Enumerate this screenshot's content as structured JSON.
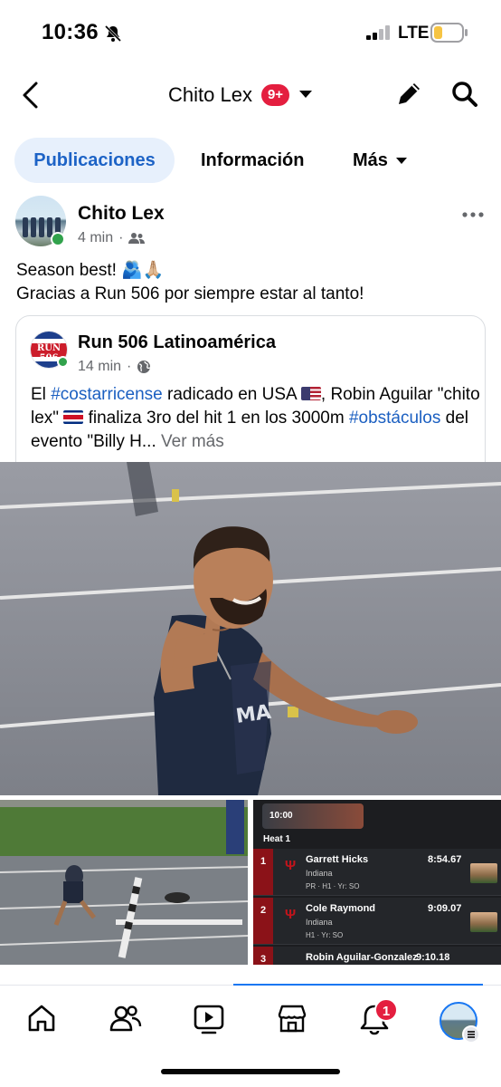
{
  "status_bar": {
    "time": "10:36",
    "network": "LTE",
    "icons": [
      "bell-slash-icon",
      "signal-icon",
      "battery-icon"
    ]
  },
  "header": {
    "title": "Chito Lex",
    "badge": "9+",
    "icons": [
      "back-icon",
      "caret-down-icon",
      "edit-icon",
      "search-icon"
    ]
  },
  "tabs": [
    {
      "label": "Publicaciones",
      "active": true
    },
    {
      "label": "Información",
      "active": false
    },
    {
      "label": "Más",
      "active": false
    }
  ],
  "post": {
    "author": "Chito Lex",
    "time": "4 min",
    "sep": "·",
    "audience_icon": "friends-icon",
    "line1": "Season best! 🫂🙏🏼",
    "line2": "Gracias a Run 506 por siempre estar al tanto!",
    "shared": {
      "page_name": "Run 506 Latinoamérica",
      "logo_text": "RUN 506",
      "time": "14 min",
      "audience_icon": "globe-icon",
      "t1": "El ",
      "tag1": "#costarricense",
      "t2": " radicado en USA ",
      "t3": ", Robin Aguilar \"chito lex\" ",
      "t4": " finaliza 3ro del hit 1 en los 3000m ",
      "tag2": "#obstáculos",
      "t5": " del evento \"Billy H... ",
      "see_more": "Ver más"
    }
  },
  "results": {
    "clock": "10:00",
    "heat": "Heat 1",
    "rows": [
      {
        "pos": "1",
        "name": "Garrett Hicks",
        "team": "Indiana",
        "time": "8:54.67",
        "info": "PR · H1 · Yr: SO"
      },
      {
        "pos": "2",
        "name": "Cole Raymond",
        "team": "Indiana",
        "time": "9:09.07",
        "info": "H1 · Yr: SO"
      },
      {
        "pos": "3",
        "name": "Robin Aguilar-Gonzalez",
        "team": "",
        "time": "9:10.18",
        "info": ""
      }
    ]
  },
  "bottom_nav": {
    "items": [
      "home-icon",
      "friends-icon",
      "video-icon",
      "marketplace-icon",
      "notifications-icon",
      "profile-icon"
    ],
    "notif_badge": "1"
  },
  "colors": {
    "accent": "#1b5fc1",
    "badge": "#e41e3f",
    "online": "#31a24c",
    "tab_active_bg": "#e7f0fc"
  }
}
